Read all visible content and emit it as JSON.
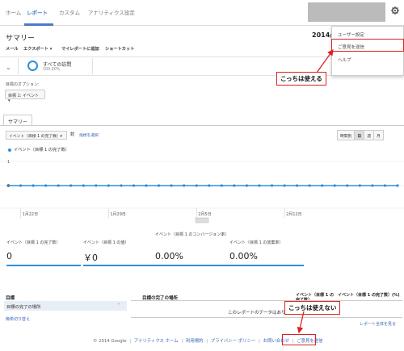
{
  "nav": {
    "tabs": [
      {
        "label": "ホーム"
      },
      {
        "label": "レポート"
      },
      {
        "label": "カスタム"
      },
      {
        "label": "アナリティクス設定"
      }
    ]
  },
  "header": {
    "page_title": "サマリー",
    "date_label": "2014/"
  },
  "toolbar": {
    "items": [
      "メール",
      "エクスポート ▾",
      "マイレポートに追加",
      "ショートカット"
    ]
  },
  "segment": {
    "name": "すべての訪問",
    "percent": "100.00%"
  },
  "goal_options": {
    "label": "目標のオプション:",
    "selected": "目標 1: イベント ▾"
  },
  "summary_tab": {
    "label": "サマリー"
  },
  "chart_controls": {
    "metric_selected": "イベント（目標 1 の完了数）▾",
    "vs": "対",
    "compare_link": "指標を選択",
    "granularity": [
      "時間別",
      "日",
      "週",
      "月"
    ],
    "granularity_active": "日"
  },
  "chart_data": {
    "type": "line",
    "series": [
      {
        "name": "イベント（目標 1 の完了数）",
        "values": [
          0,
          0,
          0,
          0,
          0,
          0,
          0,
          0,
          0,
          0,
          0,
          0,
          0,
          0,
          0,
          0,
          0,
          0,
          0,
          0,
          0,
          0,
          0,
          0,
          0,
          0,
          0,
          0,
          0,
          0,
          0,
          0
        ]
      }
    ],
    "ylim": [
      0,
      1
    ],
    "yticks": [
      "1",
      "0"
    ],
    "x_tick_labels": [
      "1月22日",
      "1月29日",
      "2月5日",
      "2月12日"
    ],
    "color": "#2f8fd8"
  },
  "scorecards": [
    {
      "label": "イベント（目標 1 の完了数）",
      "value": "0"
    },
    {
      "label": "イベント（目標 1 の値）",
      "value": "￥0"
    },
    {
      "label": "イベント（目標 1 のコンバージョン率）",
      "value": "0.00%"
    },
    {
      "label": "イベント（目標 1 の放棄率）",
      "value": "0.00%"
    }
  ],
  "goal_table": {
    "left_header": "目標",
    "left_row": "目標の完了の場所",
    "right_header": "目標の完了の場所",
    "col1_header": "イベント（目標 1 の完了数）",
    "col2_header": "イベント（目標 1 の完了数）(%)",
    "no_data": "このレポートのデータはありません",
    "easy_switch": "簡単切り替え",
    "full_report": "レポート全体を見る"
  },
  "footer": {
    "copyright": "© 2014 Google",
    "links": [
      "アナリティクス ホーム",
      "利用規約",
      "プライバシー ポリシー",
      "お問い合わせ",
      "ご意見を送信"
    ]
  },
  "dropdown": {
    "items": [
      "ユーザー設定",
      "ご意見を送信",
      "ヘルプ"
    ]
  },
  "annotations": {
    "callout_usable": "こっちは使える",
    "callout_unusable": "こっちは使えない",
    "highlight_color": "#e02020"
  },
  "colors": {
    "accent": "#4a7ac9",
    "series": "#2f8fd8"
  }
}
